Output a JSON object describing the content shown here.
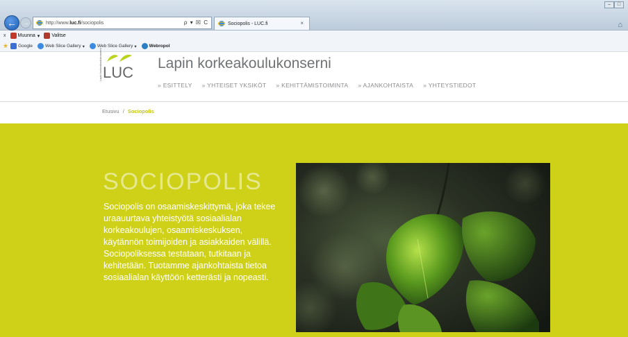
{
  "browser": {
    "url_prefix": "http://www.",
    "url_domain": "luc.fi",
    "url_path": "/sociopolis",
    "address_tools": "ρ ▾ ☒ C",
    "tab_title": "Sociopolis - LUC.fi",
    "tab_close": "×",
    "command_bar": {
      "close": "x",
      "item1": "Muunna",
      "item1_caret": "▾",
      "item2": "Valitse"
    },
    "favorites": [
      {
        "label": "Google",
        "icon": "google-icon"
      },
      {
        "label": "Web Slice Gallery",
        "icon": "ie-icon",
        "caret": "▾"
      },
      {
        "label": "Web Slice Gallery",
        "icon": "ie-icon",
        "caret": "▾"
      },
      {
        "label": "Webropol",
        "icon": "webropol-icon"
      }
    ]
  },
  "site": {
    "logo_text": "LUC",
    "logo_small": "Lapin korkeakoulukonserni",
    "title": "Lapin korkeakoulukonserni",
    "nav": [
      "» ESITTELY",
      "» YHTEISET YKSIKÖT",
      "» KEHITTÄMISTOIMINTA",
      "» AJANKOHTAISTA",
      "» YHTEYSTIEDOT"
    ],
    "breadcrumb": {
      "home": "Etusivu",
      "separator": "/",
      "current": "Sociopolis"
    }
  },
  "hero": {
    "title": "SOCIOPOLIS",
    "text": "Sociopolis on osaamiskeskittymä, joka tekee uraauurtava yhteistyötä sosiaalialan korkeakoulujen, osaamiskeskuksen, käytännön toimijoiden ja asiakkaiden välillä. Sociopoliksessa testataan, tutkitaan ja kehitetään. Tuotamme ajankohtaista tietoa sosiaalialan käyttöön ketterästi ja nopeasti."
  },
  "colors": {
    "hero_bg": "#cfd119",
    "hero_title": "#e6e88e",
    "breadcrumb_current": "#c3c41a",
    "nav_text": "#8a8d8f"
  }
}
